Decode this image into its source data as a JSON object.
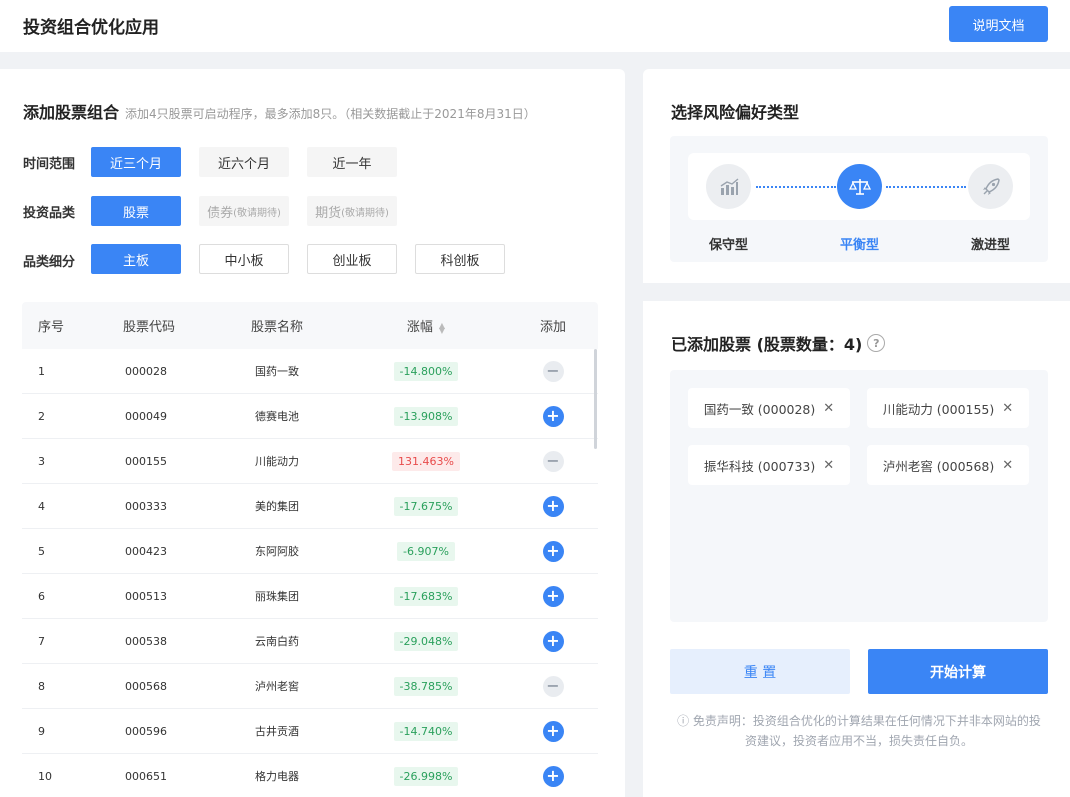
{
  "app": {
    "title": "投资组合优化应用",
    "doc_button": "说明文档"
  },
  "add_section": {
    "title": "添加股票组合",
    "subtitle": "添加4只股票可启动程序，最多添加8只。（相关数据截止于2021年8月31日）",
    "time_range": {
      "label": "时间范围",
      "options": [
        "近三个月",
        "近六个月",
        "近一年"
      ],
      "selected": "近三个月"
    },
    "product_type": {
      "label": "投资品类",
      "options": [
        "股票",
        "债券",
        "期货"
      ],
      "hint": "(敬请期待)",
      "selected": "股票"
    },
    "sub_type": {
      "label": "品类细分",
      "options": [
        "主板",
        "中小板",
        "创业板",
        "科创板"
      ],
      "selected": "主板"
    }
  },
  "table": {
    "headers": [
      "序号",
      "股票代码",
      "股票名称",
      "涨幅",
      "添加"
    ],
    "rows": [
      {
        "idx": "1",
        "code": "000028",
        "name": "国药一致",
        "change": "-14.800%",
        "dir": "down",
        "added": true
      },
      {
        "idx": "2",
        "code": "000049",
        "name": "德赛电池",
        "change": "-13.908%",
        "dir": "down",
        "added": false
      },
      {
        "idx": "3",
        "code": "000155",
        "name": "川能动力",
        "change": "131.463%",
        "dir": "up",
        "added": true
      },
      {
        "idx": "4",
        "code": "000333",
        "name": "美的集团",
        "change": "-17.675%",
        "dir": "down",
        "added": false
      },
      {
        "idx": "5",
        "code": "000423",
        "name": "东阿阿胶",
        "change": "-6.907%",
        "dir": "down",
        "added": false
      },
      {
        "idx": "6",
        "code": "000513",
        "name": "丽珠集团",
        "change": "-17.683%",
        "dir": "down",
        "added": false
      },
      {
        "idx": "7",
        "code": "000538",
        "name": "云南白药",
        "change": "-29.048%",
        "dir": "down",
        "added": false
      },
      {
        "idx": "8",
        "code": "000568",
        "name": "泸州老窖",
        "change": "-38.785%",
        "dir": "down",
        "added": true
      },
      {
        "idx": "9",
        "code": "000596",
        "name": "古井贡酒",
        "change": "-14.740%",
        "dir": "down",
        "added": false
      },
      {
        "idx": "10",
        "code": "000651",
        "name": "格力电器",
        "change": "-26.998%",
        "dir": "down",
        "added": false
      }
    ]
  },
  "risk": {
    "title": "选择风险偏好类型",
    "options": [
      {
        "label": "保守型",
        "icon": "chart-icon"
      },
      {
        "label": "平衡型",
        "icon": "scale-icon"
      },
      {
        "label": "激进型",
        "icon": "rocket-icon"
      }
    ],
    "selected": "平衡型"
  },
  "added": {
    "title": "已添加股票 (股票数量：4)",
    "stocks": [
      "国药一致 (000028)",
      "川能动力 (000155)",
      "振华科技 (000733)",
      "泸州老窖 (000568)"
    ],
    "reset": "重 置",
    "calculate": "开始计算",
    "disclaimer": "ⓘ 免责声明：投资组合优化的计算结果在任何情况下并非本网站的投资建议，投资者应用不当，损失责任自负。"
  },
  "colors": {
    "accent": "#3a85f5",
    "down": "#2aa05c",
    "up": "#e84b4b"
  }
}
